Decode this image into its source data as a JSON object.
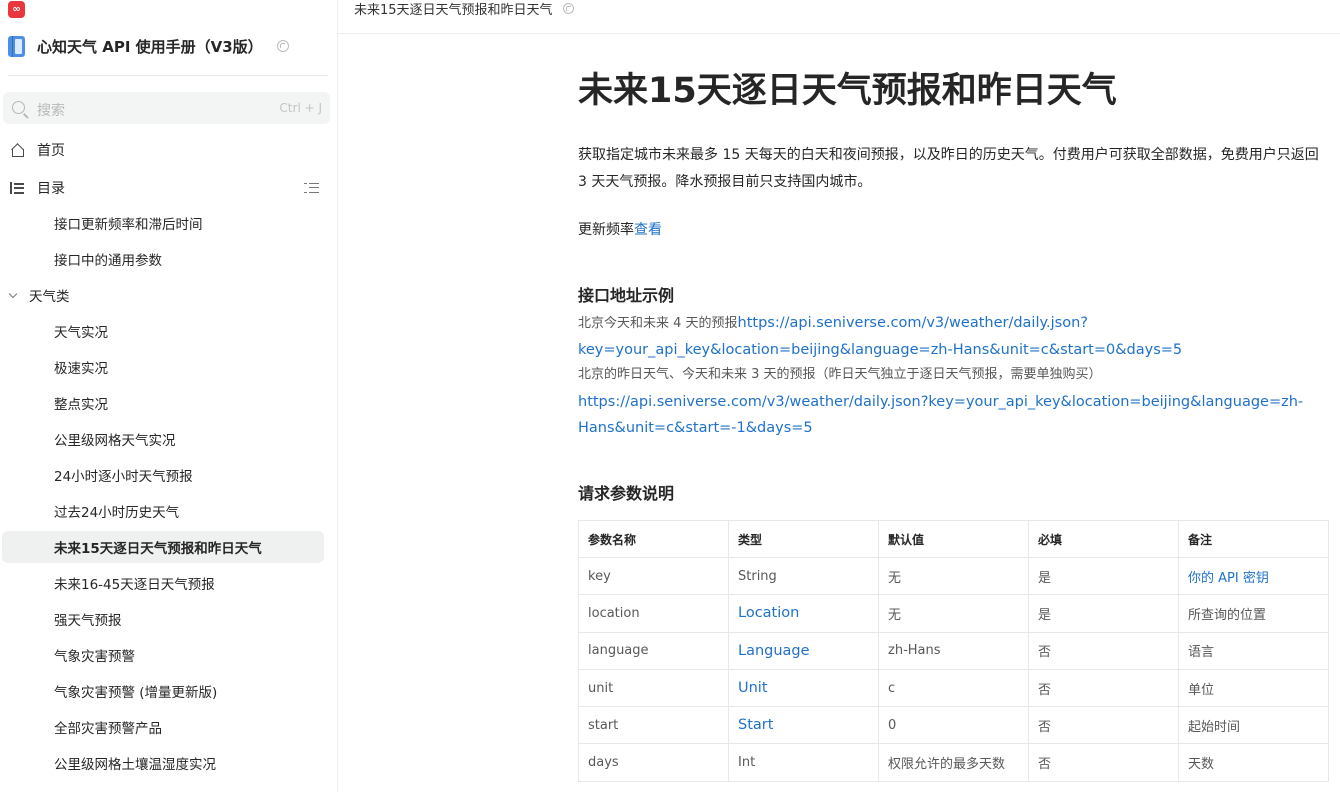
{
  "sidebar": {
    "book_title": "心知天气 API 使用手册（V3版）",
    "search": {
      "placeholder": "搜索",
      "shortcut": "Ctrl + J"
    },
    "home_label": "首页",
    "toc_label": "目录",
    "items": [
      {
        "label": "接口更新频率和滞后时间"
      },
      {
        "label": "接口中的通用参数"
      }
    ],
    "group_label": "天气类",
    "group_items": [
      {
        "label": "天气实况"
      },
      {
        "label": "极速实况"
      },
      {
        "label": "整点实况"
      },
      {
        "label": "公里级网格天气实况"
      },
      {
        "label": "24小时逐小时天气预报"
      },
      {
        "label": "过去24小时历史天气"
      },
      {
        "label": "未来15天逐日天气预报和昨日天气"
      },
      {
        "label": "未来16-45天逐日天气预报"
      },
      {
        "label": "强天气预报"
      },
      {
        "label": "气象灾害预警"
      },
      {
        "label": "气象灾害预警 (增量更新版)"
      },
      {
        "label": "全部灾害预警产品"
      },
      {
        "label": "公里级网格土壤温湿度实况"
      }
    ]
  },
  "breadcrumb": "未来15天逐日天气预报和昨日天气",
  "doc": {
    "title": "未来15天逐日天气预报和昨日天气",
    "intro": "获取指定城市未来最多 15 天每天的白天和夜间预报，以及昨日的历史天气。付费用户可获取全部数据，免费用户只返回 3 天天气预报。降水预报目前只支持国内城市。",
    "freq_prefix": "更新频率",
    "freq_link": "查看",
    "api_heading": "接口地址示例",
    "example1_label": "北京今天和未来 4 天的预报",
    "example1_url_part1": "https://api.seniverse.com/v3/weather/daily.json?",
    "example1_url_part2": "key=your_api_key&location=beijing&language=zh-Hans&unit=c&start=0&days=5",
    "example2_label": "北京的昨日天气、今天和未来 3 天的预报（昨日天气独立于逐日天气预报，需要单独购买）",
    "example2_url_part1": "https://api.seniverse.com/v3/weather/daily.json?key=your_api_key&location=beijing&language=zh-",
    "example2_url_part2": "Hans&unit=c&start=-1&days=5",
    "params_heading": "请求参数说明",
    "table": {
      "headers": [
        "参数名称",
        "类型",
        "默认值",
        "必填",
        "备注"
      ],
      "rows": [
        [
          "key",
          "String",
          "无",
          "是",
          "你的 API 密钥"
        ],
        [
          "location",
          "Location",
          "无",
          "是",
          "所查询的位置"
        ],
        [
          "language",
          "Language",
          "zh-Hans",
          "否",
          "语言"
        ],
        [
          "unit",
          "Unit",
          "c",
          "否",
          "单位"
        ],
        [
          "start",
          "Start",
          "0",
          "否",
          "起始时间"
        ],
        [
          "days",
          "Int",
          "权限允许的最多天数",
          "否",
          "天数"
        ]
      ]
    }
  },
  "colors": {
    "link": "#1f71c9",
    "active_bg": "#eff0f0",
    "logo": "#e8383d"
  },
  "logo_glyph": "∞"
}
